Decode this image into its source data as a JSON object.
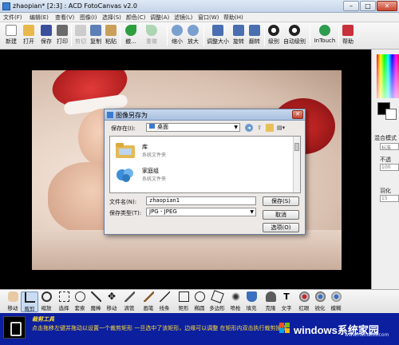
{
  "window": {
    "title": "zhaopian* [2:3] : ACD FotoCanvas v2.0"
  },
  "menu": [
    "文件(F)",
    "编辑(E)",
    "查看(V)",
    "图像(I)",
    "选择(S)",
    "颜色(C)",
    "调整(A)",
    "滤镜(L)",
    "窗口(W)",
    "帮助(H)"
  ],
  "toolbar": [
    {
      "label": "新建",
      "color": "#ffffff"
    },
    {
      "label": "打开",
      "color": "#e8b84a"
    },
    {
      "label": "保存",
      "color": "#3a4f9c"
    },
    {
      "label": "打印",
      "color": "#6b6b6b"
    },
    {
      "label": "剪切",
      "color": "#888888",
      "disabled": true
    },
    {
      "label": "复制",
      "color": "#5c7fb8"
    },
    {
      "label": "粘贴",
      "color": "#c9a05a"
    },
    {
      "label": "撤...",
      "color": "#2f9e3f"
    },
    {
      "label": "重做",
      "color": "#2f9e3f",
      "disabled": true
    },
    {
      "label": "缩小",
      "color": "#7aa0d0"
    },
    {
      "label": "放大",
      "color": "#7aa0d0"
    },
    {
      "label": "调整大小",
      "color": "#4a6fb0"
    },
    {
      "label": "旋转",
      "color": "#4a6fb0"
    },
    {
      "label": "翻转",
      "color": "#4a6fb0"
    },
    {
      "label": "级别",
      "color": "#222222"
    },
    {
      "label": "自动级别",
      "color": "#222222"
    },
    {
      "label": "InTouch",
      "color": "#2e9c4f"
    },
    {
      "label": "帮助",
      "color": "#c8303a"
    }
  ],
  "right_panel": {
    "blend_label": "混合模式",
    "blend_value": "标准",
    "opacity_label": "不透",
    "opacity_value": "100",
    "feather_label": "羽化",
    "feather_value": "15"
  },
  "dialog": {
    "title": "图像另存为",
    "save_in_label": "保存在(I):",
    "save_in_value": "桌面",
    "files": [
      {
        "name": "库",
        "type": "系统文件夹"
      },
      {
        "name": "家庭组",
        "type": "系统文件夹"
      }
    ],
    "filename_label": "文件名(N):",
    "filename_value": "zhaopian1",
    "filetype_label": "保存类型(T):",
    "filetype_value": "JPG - JPEG",
    "save_button": "保存(S)",
    "cancel_button": "取消",
    "options_button": "选项(O)"
  },
  "tools": [
    "移动",
    "裁剪",
    "缩放",
    "选择",
    "套索",
    "魔棒",
    "移动",
    "滴管",
    "画笔",
    "线条",
    "矩形",
    "椭圆",
    "多边形",
    "喷枪",
    "填充",
    "克隆",
    "文字",
    "红眼",
    "锐化",
    "模糊"
  ],
  "status": {
    "title": "裁剪工具",
    "description": "点击拖移左键并拖动以设置一个裁剪矩形 一旦选中了该矩形，边缘可以调整 在矩形内双击执行裁剪操作",
    "watermark": "windows系统家园",
    "watermark_sub": "www.nuihaitu.com"
  }
}
